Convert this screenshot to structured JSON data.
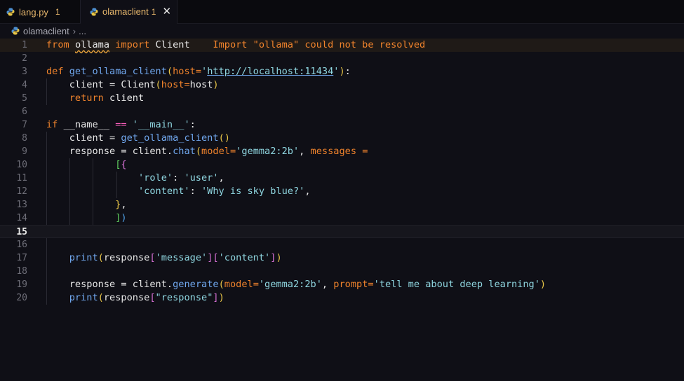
{
  "tabs": [
    {
      "name": "lang.py",
      "badge": "1"
    },
    {
      "name": "olamaclient",
      "badge": "1"
    }
  ],
  "breadcrumb": {
    "file": "olamaclient",
    "rest": "..."
  },
  "diagnostic": "Import \"ollama\" could not be resolved",
  "line_numbers": [
    "1",
    "2",
    "3",
    "4",
    "5",
    "6",
    "7",
    "8",
    "9",
    "10",
    "11",
    "12",
    "13",
    "14",
    "15",
    "16",
    "17",
    "18",
    "19",
    "20"
  ],
  "code": {
    "l1": {
      "from": "from",
      "mod": "ollama",
      "import": "import",
      "cls": "Client"
    },
    "l3": {
      "def": "def",
      "name": "get_ollama_client",
      "p_open": "(",
      "param": "host",
      "eq": "=",
      "q1": "'",
      "url": "http://localhost:11434",
      "q2": "'",
      "p_close": ")",
      "colon": ":"
    },
    "l4": {
      "var": "client",
      "eq": " = ",
      "cls": "Client",
      "p_open": "(",
      "param": "host",
      "eq2": "=",
      "arg": "host",
      "p_close": ")"
    },
    "l5": {
      "ret": "return",
      "var": "client"
    },
    "l7": {
      "if": "if",
      "name": "__name__",
      "op": "==",
      "str": "'__main__'",
      "colon": ":"
    },
    "l8": {
      "var": "client",
      "eq": " = ",
      "fn": "get_ollama_client",
      "parens": "()"
    },
    "l9": {
      "var": "response",
      "eq": " = ",
      "obj": "client.",
      "fn": "chat",
      "p_open": "(",
      "param": "model",
      "eq2": "=",
      "str": "'gemma2:2b'",
      "comma": ", ",
      "param2": "messages",
      "eq3": " ="
    },
    "l10": {
      "b1": "[",
      "b2": "{"
    },
    "l11": {
      "key": "'role'",
      "colon": ": ",
      "val": "'user'",
      "comma": ","
    },
    "l12": {
      "key": "'content'",
      "colon": ": ",
      "val": "'Why is sky blue?'",
      "comma": ","
    },
    "l13": {
      "b": "}",
      "comma": ","
    },
    "l14": {
      "b1": "]",
      "b2": ")"
    },
    "l17": {
      "fn": "print",
      "p1": "(",
      "var": "response",
      "b1": "[",
      "s1": "'message'",
      "b2": "][",
      "s2": "'content'",
      "b3": "]",
      "p2": ")"
    },
    "l19": {
      "var": "response",
      "eq": " = ",
      "obj": "client.",
      "fn": "generate",
      "p_open": "(",
      "param": "model",
      "eq2": "=",
      "str": "'gemma2:2b'",
      "comma": ", ",
      "param2": "prompt",
      "eq3": "=",
      "str2": "'tell me about deep learning'",
      "p_close": ")"
    },
    "l20": {
      "fn": "print",
      "p1": "(",
      "var": "response",
      "b1": "[",
      "s1": "\"response\"",
      "b2": "]",
      "p2": ")"
    }
  },
  "colors": {
    "background": "#0f0f16",
    "keyword": "#f0832c",
    "function": "#71a8ef",
    "string": "#8fd6e0",
    "warning": "#e8b86d"
  },
  "icons": {
    "tab_file": "python-icon",
    "close": "close-icon"
  }
}
